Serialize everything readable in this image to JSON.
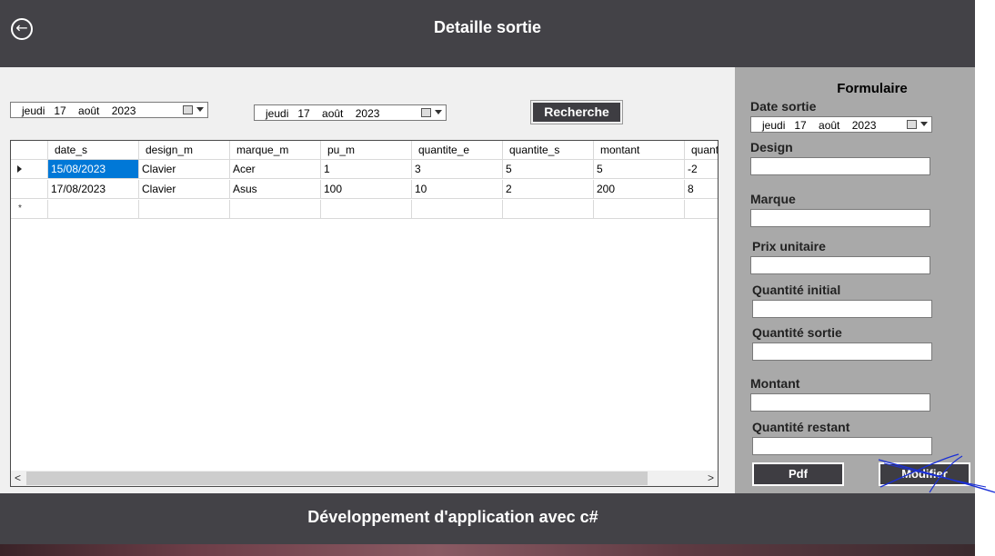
{
  "header": {
    "title": "Detaille sortie",
    "back_icon": "←"
  },
  "filters": {
    "date_from": "jeudi   17    août    2023",
    "date_to": "jeudi   17    août    2023",
    "search_label": "Recherche"
  },
  "grid": {
    "columns": [
      "date_s",
      "design_m",
      "marque_m",
      "pu_m",
      "quantite_e",
      "quantite_s",
      "montant",
      "quantit"
    ],
    "rows": [
      [
        "15/08/2023",
        "Clavier",
        "Acer",
        "1",
        "3",
        "5",
        "5",
        "-2"
      ],
      [
        "17/08/2023",
        "Clavier",
        "Asus",
        "100",
        "10",
        "2",
        "200",
        "8"
      ]
    ],
    "new_row_marker": "*",
    "scroll_left": "<",
    "scroll_right": ">"
  },
  "form": {
    "title": "Formulaire",
    "date_label": "Date sortie",
    "date_value": "jeudi   17    août    2023",
    "design_label": "Design",
    "marque_label": "Marque",
    "prix_label": "Prix unitaire",
    "qte_initial_label": "Quantité initial",
    "qte_sortie_label": "Quantité sortie",
    "montant_label": "Montant",
    "qte_restant_label": "Quantité restant",
    "pdf_label": "Pdf",
    "modifier_label": "Modifier"
  },
  "footer": {
    "text": "Développement d'application avec c#"
  },
  "colors": {
    "dark": "#434247",
    "selection": "#0078d7",
    "panel": "#a9a9a9",
    "scribble": "#1a2fd6"
  }
}
